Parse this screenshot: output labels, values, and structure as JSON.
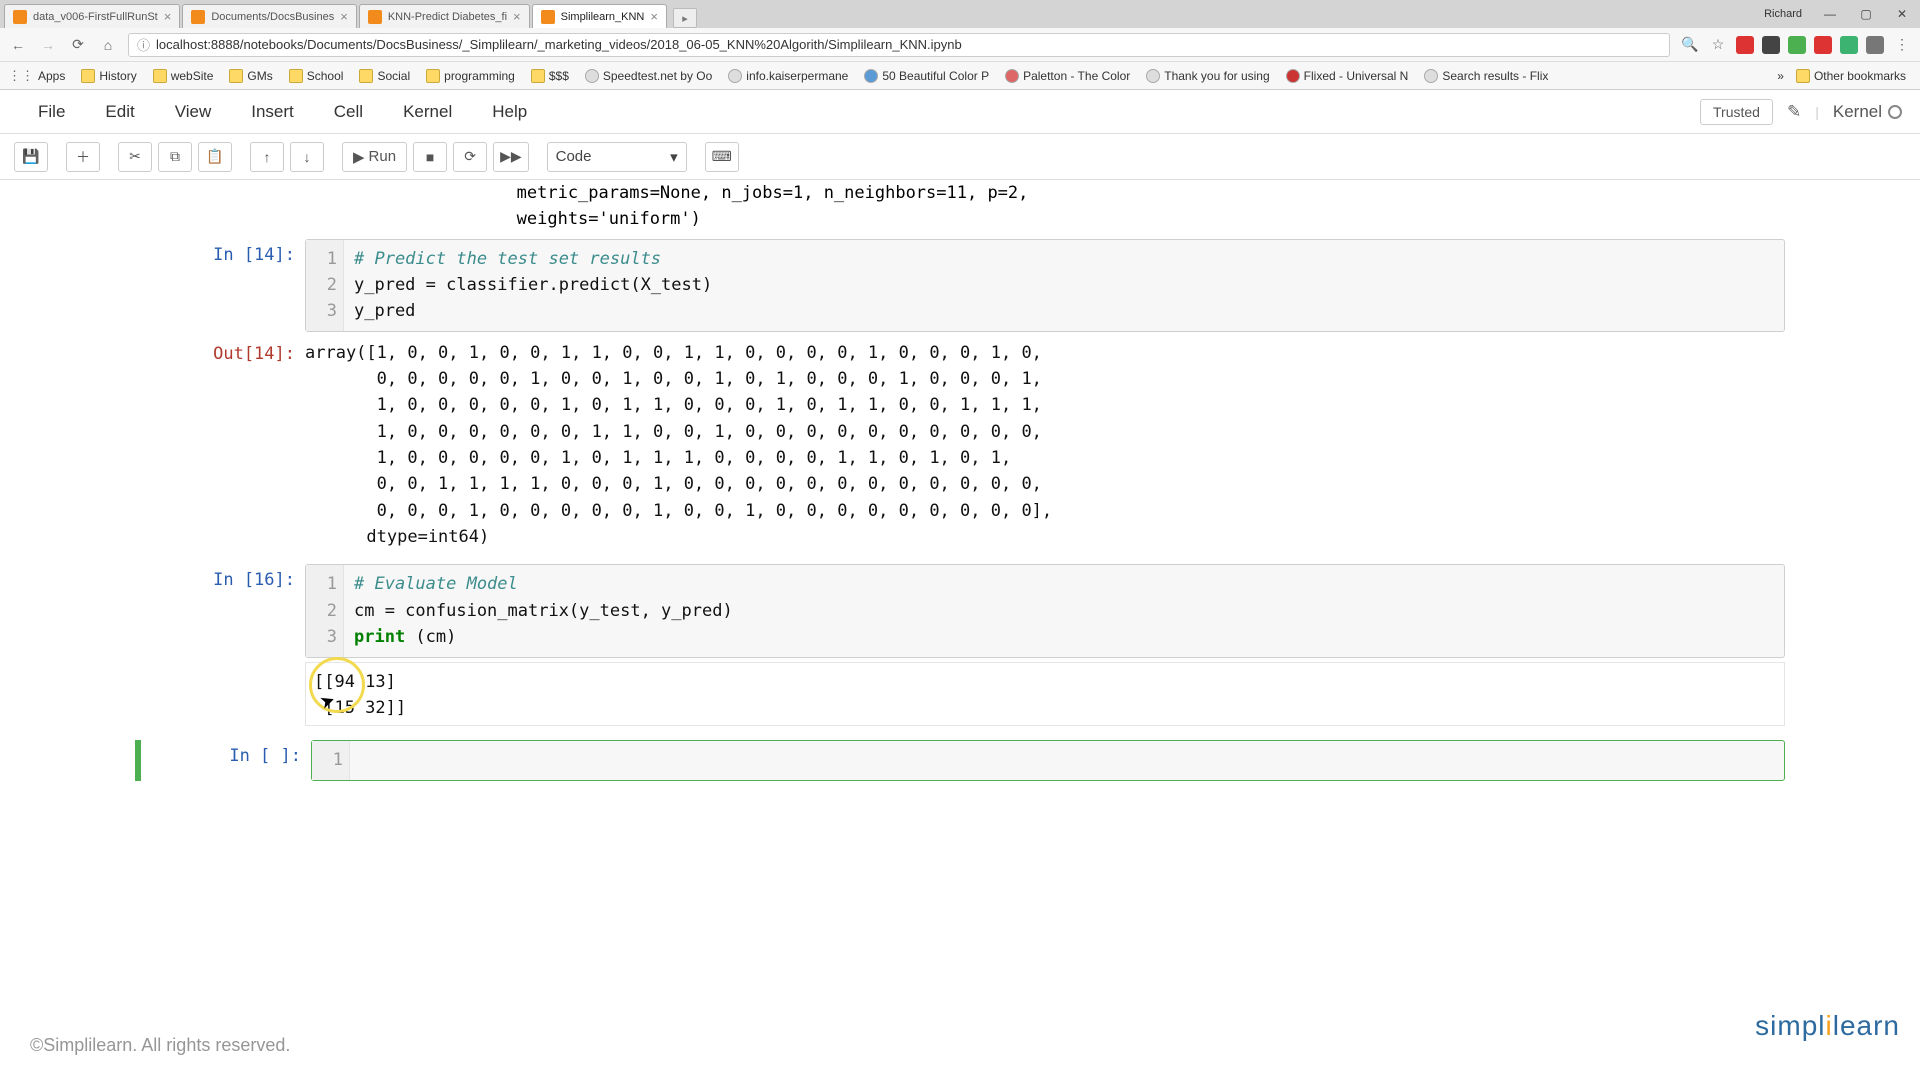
{
  "window": {
    "user": "Richard"
  },
  "tabs": [
    {
      "label": "data_v006-FirstFullRunSt",
      "active": false
    },
    {
      "label": "Documents/DocsBusines",
      "active": false
    },
    {
      "label": "KNN-Predict Diabetes_fi",
      "active": false
    },
    {
      "label": "Simplilearn_KNN",
      "active": true
    }
  ],
  "url": "localhost:8888/notebooks/Documents/DocsBusiness/_Simplilearn/_marketing_videos/2018_06-05_KNN%20Algorith/Simplilearn_KNN.ipynb",
  "bookmarks": {
    "left": [
      {
        "label": "Apps",
        "folder": true
      },
      {
        "label": "History",
        "folder": true
      },
      {
        "label": "webSite",
        "folder": true
      },
      {
        "label": "GMs",
        "folder": true
      },
      {
        "label": "School",
        "folder": true
      },
      {
        "label": "Social",
        "folder": true
      },
      {
        "label": "programming",
        "folder": true
      },
      {
        "label": "$$$",
        "folder": true
      },
      {
        "label": "Speedtest.net by Oo",
        "folder": false
      },
      {
        "label": "info.kaiserpermane",
        "folder": false
      },
      {
        "label": "50 Beautiful Color P",
        "folder": false
      },
      {
        "label": "Paletton - The Color",
        "folder": false
      },
      {
        "label": "Thank you for using",
        "folder": false
      },
      {
        "label": "Flixed - Universal N",
        "folder": false
      },
      {
        "label": "Search results - Flix",
        "folder": false
      }
    ],
    "more": "»",
    "right": "Other bookmarks"
  },
  "menu": [
    "File",
    "Edit",
    "View",
    "Insert",
    "Cell",
    "Kernel",
    "Help"
  ],
  "trusted": "Trusted",
  "kernel_label": "Kernel",
  "toolbar": {
    "run": "Run",
    "celltype": "Code"
  },
  "notebook": {
    "topcut": "       metric_params=None, n_jobs=1, n_neighbors=11, p=2,\n       weights='uniform')",
    "cell14": {
      "prompt": "In [14]:",
      "gutter": "1\n2\n3",
      "line1": "# Predict the test set results",
      "line2": "y_pred = classifier.predict(X_test)",
      "line3": "y_pred"
    },
    "out14": {
      "prompt": "Out[14]:",
      "text": "array([1, 0, 0, 1, 0, 0, 1, 1, 0, 0, 1, 1, 0, 0, 0, 0, 1, 0, 0, 0, 1, 0,\n       0, 0, 0, 0, 0, 1, 0, 0, 1, 0, 0, 1, 0, 1, 0, 0, 0, 1, 0, 0, 0, 1,\n       1, 0, 0, 0, 0, 0, 1, 0, 1, 1, 0, 0, 0, 1, 0, 1, 1, 0, 0, 1, 1, 1,\n       1, 0, 0, 0, 0, 0, 0, 1, 1, 0, 0, 1, 0, 0, 0, 0, 0, 0, 0, 0, 0, 0,\n       1, 0, 0, 0, 0, 0, 1, 0, 1, 1, 1, 0, 0, 0, 0, 1, 1, 0, 1, 0, 1,\n       0, 0, 1, 1, 1, 1, 0, 0, 0, 1, 0, 0, 0, 0, 0, 0, 0, 0, 0, 0, 0, 0,\n       0, 0, 0, 1, 0, 0, 0, 0, 0, 1, 0, 0, 1, 0, 0, 0, 0, 0, 0, 0, 0, 0],\n      dtype=int64)"
    },
    "cell16": {
      "prompt": "In [16]:",
      "gutter": "1\n2\n3",
      "line1": "# Evaluate Model",
      "line2": "cm = confusion_matrix(y_test, y_pred)",
      "line3": "print (cm)"
    },
    "out16": "[[94 13]\n [15 32]]",
    "empty": {
      "prompt": "In [ ]:",
      "gutter": "1"
    }
  },
  "watermark": {
    "a": "simpl",
    "b": "i",
    "c": "learn"
  },
  "footer": "©Simplilearn. All rights reserved."
}
